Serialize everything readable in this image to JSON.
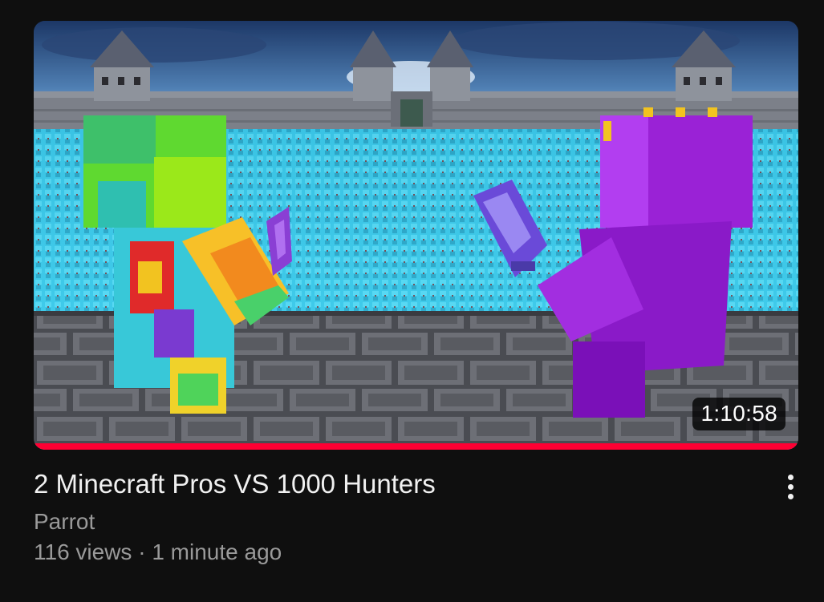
{
  "video": {
    "title": "2 Minecraft Pros VS 1000 Hunters",
    "channel": "Parrot",
    "views": "116 views",
    "separator": " · ",
    "age": "1 minute ago",
    "duration": "1:10:58",
    "watch_progress": 1.0,
    "progress_color": "#ff0033"
  },
  "icons": {
    "more": "more-vert-icon"
  },
  "colors": {
    "background": "#0f0f0f",
    "title": "#f1f1f1",
    "secondary_text": "#9a9a9a",
    "badge_bg": "#000000"
  }
}
